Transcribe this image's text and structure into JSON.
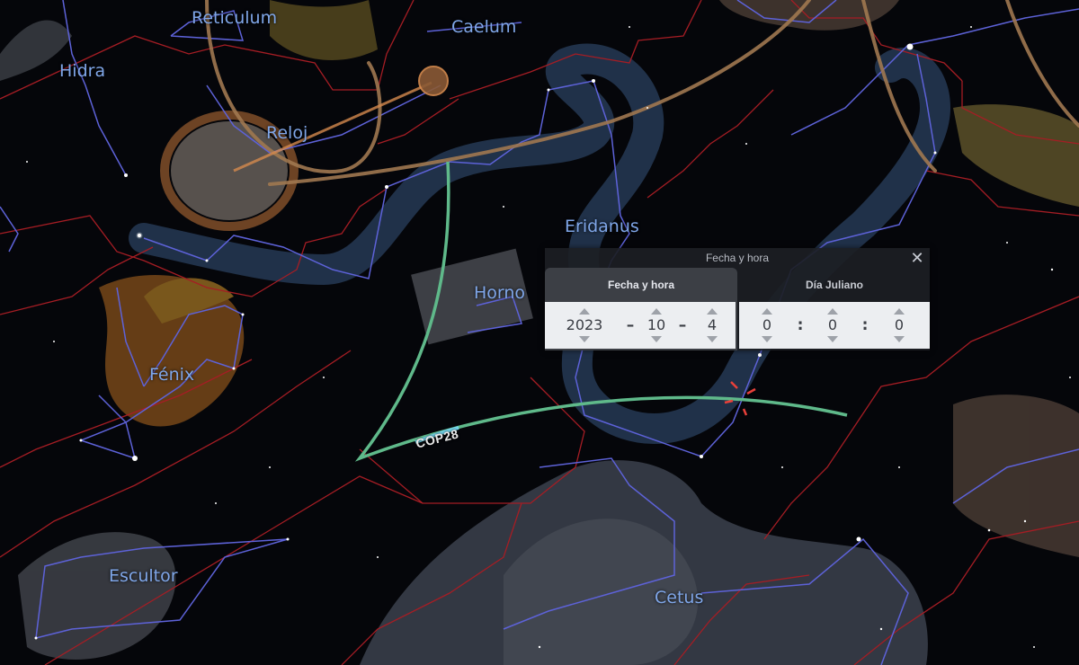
{
  "constellations": {
    "hidra": "Hidra",
    "reticulum": "Reticulum",
    "caelum": "Caelum",
    "reloj": "Reloj",
    "eridanus": "Eridanus",
    "horno": "Horno",
    "fenix": "Fénix",
    "escultor": "Escultor",
    "cetus": "Cetus"
  },
  "marker": {
    "label": "COP28"
  },
  "colors": {
    "boundary": "#a51d24",
    "lines": "#5d62d8",
    "labels": "#7fa6e8",
    "ecliptic": "#a07850",
    "path": "#5fb98a"
  },
  "dialog": {
    "title": "Fecha y hora",
    "close_icon": "close-icon",
    "tabs": {
      "date": {
        "label": "Fecha y hora",
        "year": "2023",
        "month": "10",
        "day": "4",
        "separator": "–"
      },
      "julian": {
        "label": "Día Juliano",
        "hours": "0",
        "minutes": "0",
        "seconds": "0",
        "separator": ":"
      }
    }
  }
}
